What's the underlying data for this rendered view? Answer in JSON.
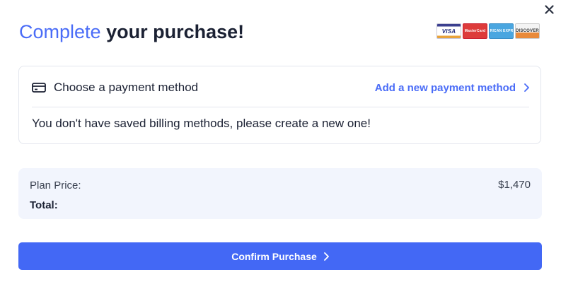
{
  "dialog": {
    "close_icon": "close-icon",
    "title_accent": "Complete",
    "title_rest": "your purchase!",
    "card_logos": [
      {
        "name": "visa",
        "text": "VISA"
      },
      {
        "name": "mastercard",
        "text": "MasterCard"
      },
      {
        "name": "amex",
        "text": "AMERICAN EXPRESS"
      },
      {
        "name": "discover",
        "text": "DISCOVER"
      }
    ]
  },
  "payment_method": {
    "icon": "credit-card-icon",
    "label": "Choose a payment method",
    "add_link": "Add a new payment method",
    "message": "You don't have saved billing methods, please create a new one!"
  },
  "summary": {
    "plan_price_label": "Plan Price:",
    "plan_price_value": "$1,470",
    "total_label": "Total:"
  },
  "actions": {
    "confirm_label": "Confirm Purchase"
  },
  "colors": {
    "accent": "#4a6cf7",
    "button": "#4368f5",
    "summary_bg": "#f2f5fd",
    "text": "#1b2133"
  }
}
